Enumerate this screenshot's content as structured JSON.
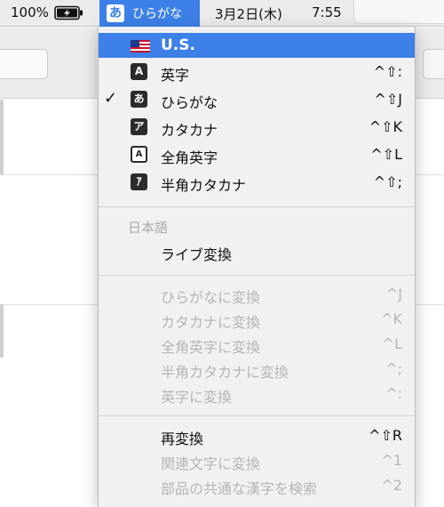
{
  "menubar": {
    "battery_percent": "100%",
    "battery_icon": "battery-charging-icon",
    "ime_glyph": "あ",
    "ime_label": "ひらがな",
    "date": "3月2日(木)",
    "time": "7:55"
  },
  "menu": {
    "input_sources": [
      {
        "label": "U.S.",
        "icon": "us-flag-icon",
        "icon_text": "",
        "shortcut": "",
        "checked": false,
        "highlighted": true
      },
      {
        "label": "英字",
        "icon": "alphanumeric-icon",
        "icon_text": "A",
        "shortcut": "^⇧:",
        "checked": false,
        "highlighted": false
      },
      {
        "label": "ひらがな",
        "icon": "hiragana-icon",
        "icon_text": "あ",
        "shortcut": "^⇧J",
        "checked": true,
        "highlighted": false
      },
      {
        "label": "カタカナ",
        "icon": "katakana-icon",
        "icon_text": "ア",
        "shortcut": "^⇧K",
        "checked": false,
        "highlighted": false
      },
      {
        "label": "全角英字",
        "icon": "fullwidth-alphanumeric-icon",
        "icon_text": "A",
        "shortcut": "^⇧L",
        "checked": false,
        "highlighted": false
      },
      {
        "label": "半角カタカナ",
        "icon": "halfwidth-katakana-icon",
        "icon_text": "ｱ",
        "shortcut": "^⇧;",
        "checked": false,
        "highlighted": false
      }
    ],
    "check_mark": "✓",
    "section_header": "日本語",
    "live_conversion": "ライブ変換",
    "convert_items": [
      {
        "label": "ひらがなに変換",
        "shortcut": "^J"
      },
      {
        "label": "カタカナに変換",
        "shortcut": "^K"
      },
      {
        "label": "全角英字に変換",
        "shortcut": "^L"
      },
      {
        "label": "半角カタカナに変換",
        "shortcut": "^;"
      },
      {
        "label": "英字に変換",
        "shortcut": "^:"
      }
    ],
    "reconvert": {
      "label": "再変換",
      "shortcut": "^⇧R"
    },
    "related_chars": {
      "label": "関連文字に変換",
      "shortcut": "^1"
    },
    "search_kanji": {
      "label": "部品の共通な漢字を検索",
      "shortcut": "^2"
    }
  },
  "colors": {
    "highlight": "#3c80e8",
    "menu_bg": "#f1f1f1",
    "disabled_text": "#b5b5b5"
  }
}
